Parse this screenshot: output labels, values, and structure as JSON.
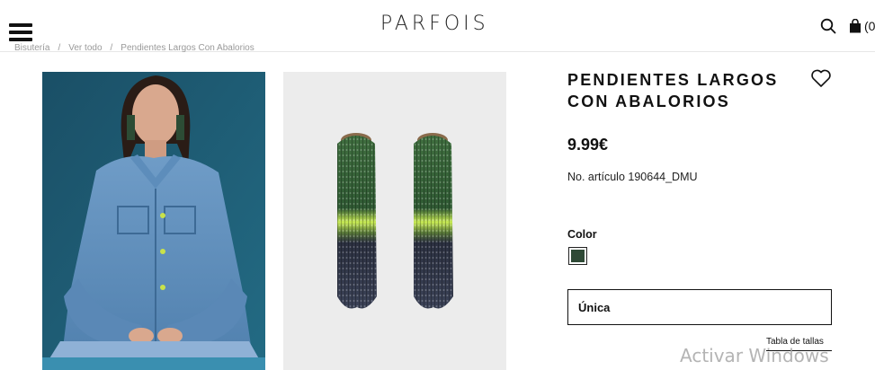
{
  "header": {
    "logo": "PARFOIS",
    "bag_count": "(0"
  },
  "breadcrumb": {
    "items": [
      "Bisutería",
      "Ver todo",
      "Pendientes Largos Con Abalorios"
    ],
    "separator": "/"
  },
  "product": {
    "title_line1": "PENDIENTES LARGOS",
    "title_line2": "CON ABALORIOS",
    "price": "9.99€",
    "sku": "No. artículo 190644_DMU",
    "color_label": "Color",
    "color_swatch_hex": "#2f4a36",
    "size_value": "Única",
    "size_guide": "Tabla de tallas"
  },
  "images": {
    "model_icon": "model-photo",
    "product_icon": "earrings-photo"
  },
  "system": {
    "watermark": "Activar Windows"
  },
  "icons": {
    "menu": "hamburger-icon",
    "search": "search-icon",
    "bag": "shopping-bag-icon",
    "wishlist": "heart-icon"
  }
}
